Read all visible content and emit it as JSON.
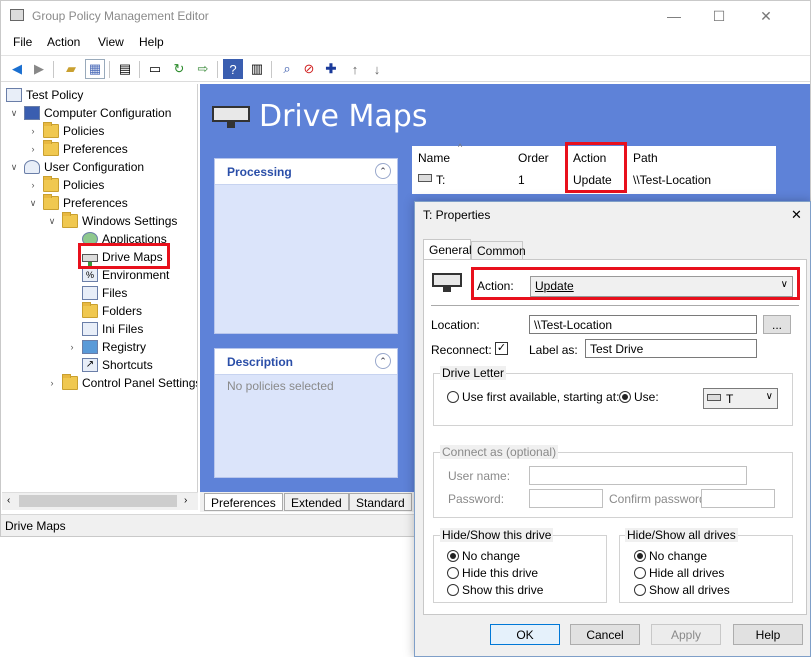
{
  "window": {
    "title": "Group Policy Management Editor",
    "minimize_glyph": "—",
    "maximize_glyph": "☐",
    "close_glyph": "✕"
  },
  "menu": [
    "File",
    "Action",
    "View",
    "Help"
  ],
  "tree": {
    "items": [
      {
        "label": "Test Policy",
        "icon": "policy-icon"
      },
      {
        "label": "Computer Configuration",
        "icon": "computer-icon"
      },
      {
        "label": "Policies",
        "icon": "folder-icon"
      },
      {
        "label": "Preferences",
        "icon": "folder-icon"
      },
      {
        "label": "User Configuration",
        "icon": "user-icon"
      },
      {
        "label": "Policies",
        "icon": "folder-icon"
      },
      {
        "label": "Preferences",
        "icon": "folder-icon"
      },
      {
        "label": "Windows Settings",
        "icon": "folder-open-icon"
      },
      {
        "label": "Applications",
        "icon": "applications-icon"
      },
      {
        "label": "Drive Maps",
        "icon": "drive-icon"
      },
      {
        "label": "Environment",
        "icon": "environment-icon"
      },
      {
        "label": "Files",
        "icon": "files-icon"
      },
      {
        "label": "Folders",
        "icon": "folders-icon"
      },
      {
        "label": "Ini Files",
        "icon": "ini-files-icon"
      },
      {
        "label": "Registry",
        "icon": "registry-icon"
      },
      {
        "label": "Shortcuts",
        "icon": "shortcuts-icon"
      },
      {
        "label": "Control Panel Settings",
        "icon": "control-panel-icon"
      }
    ]
  },
  "main": {
    "title": "Drive Maps",
    "processing_label": "Processing",
    "description_label": "Description",
    "description_text": "No policies selected",
    "columns": [
      "Name",
      "Order",
      "Action",
      "Path"
    ],
    "rows": [
      {
        "name": "T:",
        "order": "1",
        "action": "Update",
        "path": "\\\\Test-Location"
      }
    ],
    "bottom_tabs": [
      "Preferences",
      "Extended",
      "Standard"
    ]
  },
  "status": {
    "text": "Drive Maps"
  },
  "dialog": {
    "title": "T: Properties",
    "close_glyph": "✕",
    "tabs": [
      "General",
      "Common"
    ],
    "action_label": "Action:",
    "action_value": "Update",
    "location_label": "Location:",
    "location_value": "\\\\Test-Location",
    "browse_label": "...",
    "reconnect_label": "Reconnect:",
    "reconnect_checked": true,
    "label_as_label": "Label as:",
    "label_as_value": "Test Drive",
    "drive_letter_group": "Drive Letter",
    "use_first_label": "Use first available, starting at:",
    "use_label": "Use:",
    "drive_letter_value": "T",
    "connect_as_group": "Connect as (optional)",
    "user_name_label": "User name:",
    "password_label": "Password:",
    "confirm_password_label": "Confirm password:",
    "hide_show_drive_group": "Hide/Show this drive",
    "hide_show_drive_options": [
      "No change",
      "Hide this drive",
      "Show this drive"
    ],
    "hide_show_all_group": "Hide/Show all drives",
    "hide_show_all_options": [
      "No change",
      "Hide all drives",
      "Show all drives"
    ],
    "buttons": {
      "ok": "OK",
      "cancel": "Cancel",
      "apply": "Apply",
      "help": "Help"
    }
  },
  "colors": {
    "accent_blue": "#5e82d8",
    "highlight_red": "#e8101c",
    "panel_fill": "#dbe4fa"
  }
}
